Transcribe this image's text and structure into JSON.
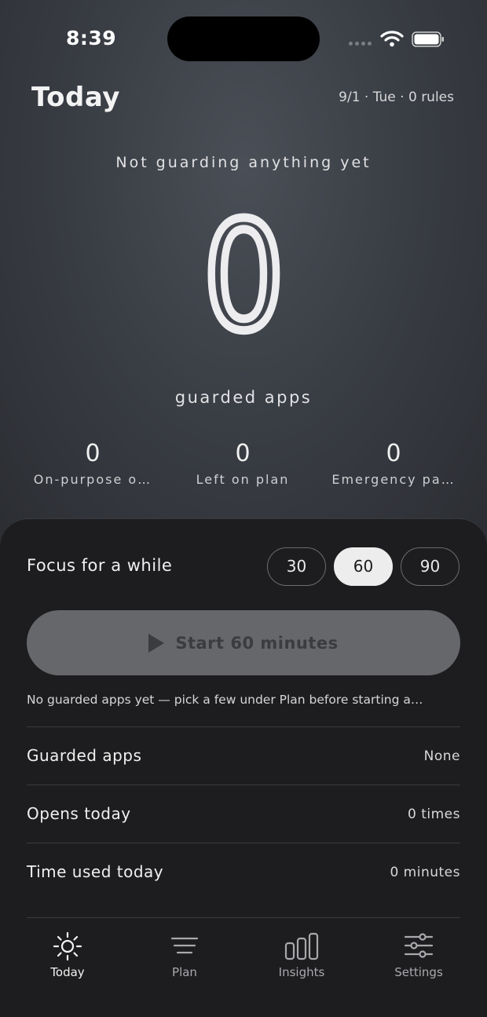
{
  "status_bar": {
    "time": "8:39"
  },
  "header": {
    "title": "Today",
    "date_line": "9/1 · Tue · 0 rules"
  },
  "summary": {
    "status_text": "Not guarding anything yet",
    "guarded_count": "0",
    "guarded_label": "guarded apps",
    "stats": [
      {
        "value": "0",
        "label": "On-purpose o…"
      },
      {
        "value": "0",
        "label": "Left on plan"
      },
      {
        "value": "0",
        "label": "Emergency pa…"
      }
    ]
  },
  "focus": {
    "label": "Focus for a while",
    "durations": [
      "30",
      "60",
      "90"
    ],
    "selected": "60",
    "start_label": "Start 60 minutes",
    "hint": "No guarded apps yet — pick a few under Plan before starting a…"
  },
  "rows": [
    {
      "label": "Guarded apps",
      "value": "None"
    },
    {
      "label": "Opens today",
      "value": "0 times"
    },
    {
      "label": "Time used today",
      "value": "0 minutes"
    }
  ],
  "tabs": [
    {
      "label": "Today",
      "icon": "sun-icon",
      "active": true
    },
    {
      "label": "Plan",
      "icon": "menu-lines-icon",
      "active": false
    },
    {
      "label": "Insights",
      "icon": "bar-chart-icon",
      "active": false
    },
    {
      "label": "Settings",
      "icon": "sliders-icon",
      "active": false
    }
  ],
  "colors": {
    "accent_pill": "#ededed",
    "start_button": "#66676b",
    "sheet_bg": "#1d1d1f"
  }
}
